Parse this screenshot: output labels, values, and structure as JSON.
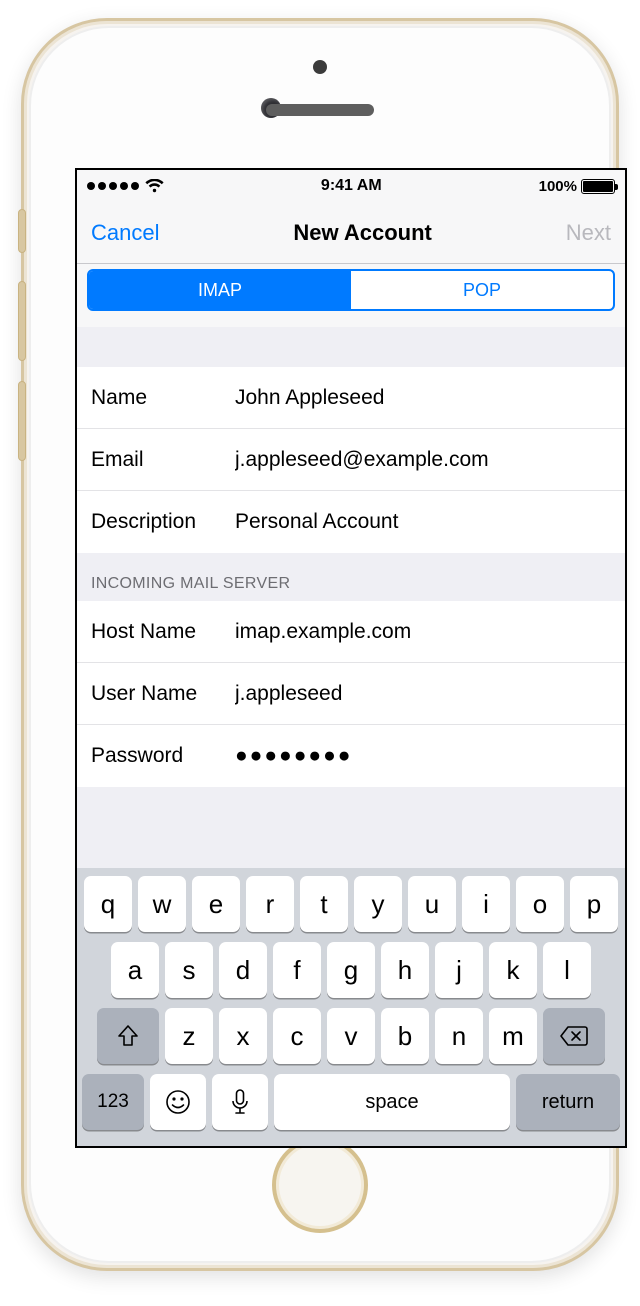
{
  "statusbar": {
    "time": "9:41 AM",
    "battery_pct": "100%"
  },
  "navbar": {
    "cancel": "Cancel",
    "title": "New Account",
    "next": "Next"
  },
  "segmented": {
    "imap": "IMAP",
    "pop": "POP",
    "selected": "IMAP"
  },
  "account": {
    "name_label": "Name",
    "name_value": "John Appleseed",
    "email_label": "Email",
    "email_value": "j.appleseed@example.com",
    "desc_label": "Description",
    "desc_value": "Personal Account"
  },
  "incoming": {
    "header": "INCOMING MAIL SERVER",
    "host_label": "Host Name",
    "host_value": "imap.example.com",
    "user_label": "User Name",
    "user_value": "j.appleseed",
    "pass_label": "Password",
    "pass_value": "●●●●●●●●"
  },
  "keyboard": {
    "row1": [
      "q",
      "w",
      "e",
      "r",
      "t",
      "y",
      "u",
      "i",
      "o",
      "p"
    ],
    "row2": [
      "a",
      "s",
      "d",
      "f",
      "g",
      "h",
      "j",
      "k",
      "l"
    ],
    "row3": [
      "z",
      "x",
      "c",
      "v",
      "b",
      "n",
      "m"
    ],
    "k123": "123",
    "space": "space",
    "return": "return"
  }
}
